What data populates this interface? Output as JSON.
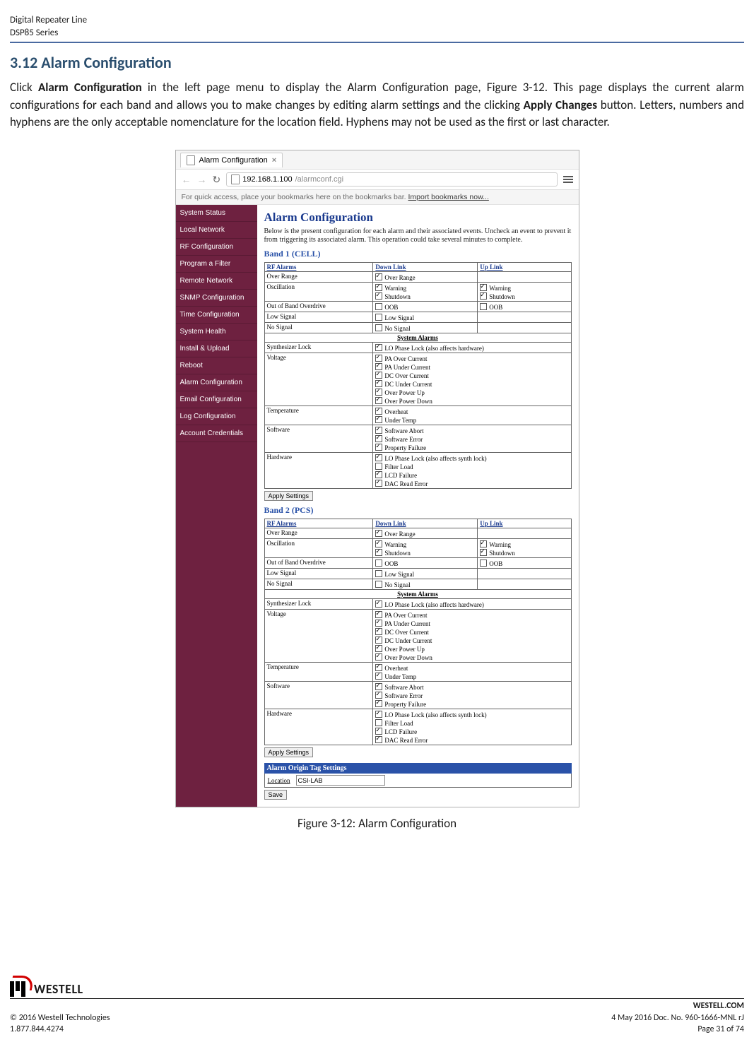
{
  "doc_header": {
    "line1": "Digital Repeater Line",
    "line2": "DSP85 Series"
  },
  "section": {
    "number_title": "3.12  Alarm Configuration",
    "para_prefix": "Click ",
    "para_bold1": "Alarm Configuration",
    "para_mid1": " in the left page menu to display the Alarm Configuration page, Figure 3-12.  This page displays the current alarm configurations for each band and allows you to make changes by editing alarm settings and the clicking ",
    "para_bold2": "Apply Changes",
    "para_suffix": " button. Letters, numbers and hyphens are the only acceptable nomenclature for the location field.  Hyphens may not be used as the first or last character."
  },
  "screenshot": {
    "tab_title": "Alarm Configuration",
    "url_host": "192.168.1.100",
    "url_path": "/alarmconf.cgi",
    "bookmark_hint_prefix": "For quick access, place your bookmarks here on the bookmarks bar. ",
    "bookmark_hint_link": "Import bookmarks now...",
    "sidebar_items": [
      "System Status",
      "Local Network",
      "RF Configuration",
      "Program a Filter",
      "Remote Network",
      "SNMP Configuration",
      "Time Configuration",
      "System Health",
      "Install & Upload",
      "Reboot",
      "Alarm Configuration",
      "Email Configuration",
      "Log Configuration",
      "Account Credentials"
    ],
    "main_title": "Alarm Configuration",
    "intro_text": "Below is the present configuration for each alarm and their associated events. Uncheck an event to prevent it from triggering its associated alarm. This operation could take several minutes to complete.",
    "band1_title": "Band 1 (CELL)",
    "band2_title": "Band 2 (PCS)",
    "col_headers": {
      "c1": "RF Alarms",
      "c2": "Down Link",
      "c3": "Up Link"
    },
    "sys_sub": "System Alarms",
    "rf_rows": [
      {
        "name": "Over Range",
        "dl": [
          "Over Range"
        ],
        "ul": []
      },
      {
        "name": "Oscillation",
        "dl": [
          "Warning",
          "Shutdown"
        ],
        "ul": [
          "Warning",
          "Shutdown"
        ]
      },
      {
        "name": "Out of Band Overdrive",
        "dl": [
          "OOB"
        ],
        "ul": [
          "OOB"
        ],
        "dl_unchecked": true,
        "ul_unchecked": true
      },
      {
        "name": "Low Signal",
        "dl": [
          "Low Signal"
        ],
        "ul": [],
        "dl_unchecked": true
      },
      {
        "name": "No Signal",
        "dl": [
          "No Signal"
        ],
        "ul": [],
        "dl_unchecked": true
      }
    ],
    "sys_rows": [
      {
        "name": "Synthesizer Lock",
        "items": [
          "LO Phase Lock (also affects hardware)"
        ]
      },
      {
        "name": "Voltage",
        "items": [
          "PA Over Current",
          "PA Under Current",
          "DC Over Current",
          "DC Under Current",
          "Over Power Up",
          "Over Power Down"
        ]
      },
      {
        "name": "Temperature",
        "items": [
          "Overheat",
          "Under Temp"
        ]
      },
      {
        "name": "Software",
        "items": [
          "Software Abort",
          "Software Error",
          "Property Failure"
        ]
      },
      {
        "name": "Hardware",
        "items": [
          "LO Phase Lock (also affects synth lock)",
          "Filter Load",
          "LCD Failure",
          "DAC Read Error"
        ],
        "unchecked_idx": 1
      }
    ],
    "apply_label": "Apply Settings",
    "origin_header": "Alarm Origin Tag Settings",
    "origin_label": "Location",
    "origin_value": "CSI-LAB",
    "save_label": "Save"
  },
  "figure_caption": "Figure 3-12: Alarm Configuration",
  "footer": {
    "logo_text": "WESTELL",
    "site": "WESTELL.COM",
    "copyright": "© 2016 Westell Technologies",
    "docline": "4 May 2016 Doc. No. 960-1666-MNL rJ",
    "phone": "1.877.844.4274",
    "page": "Page 31 of 74"
  }
}
